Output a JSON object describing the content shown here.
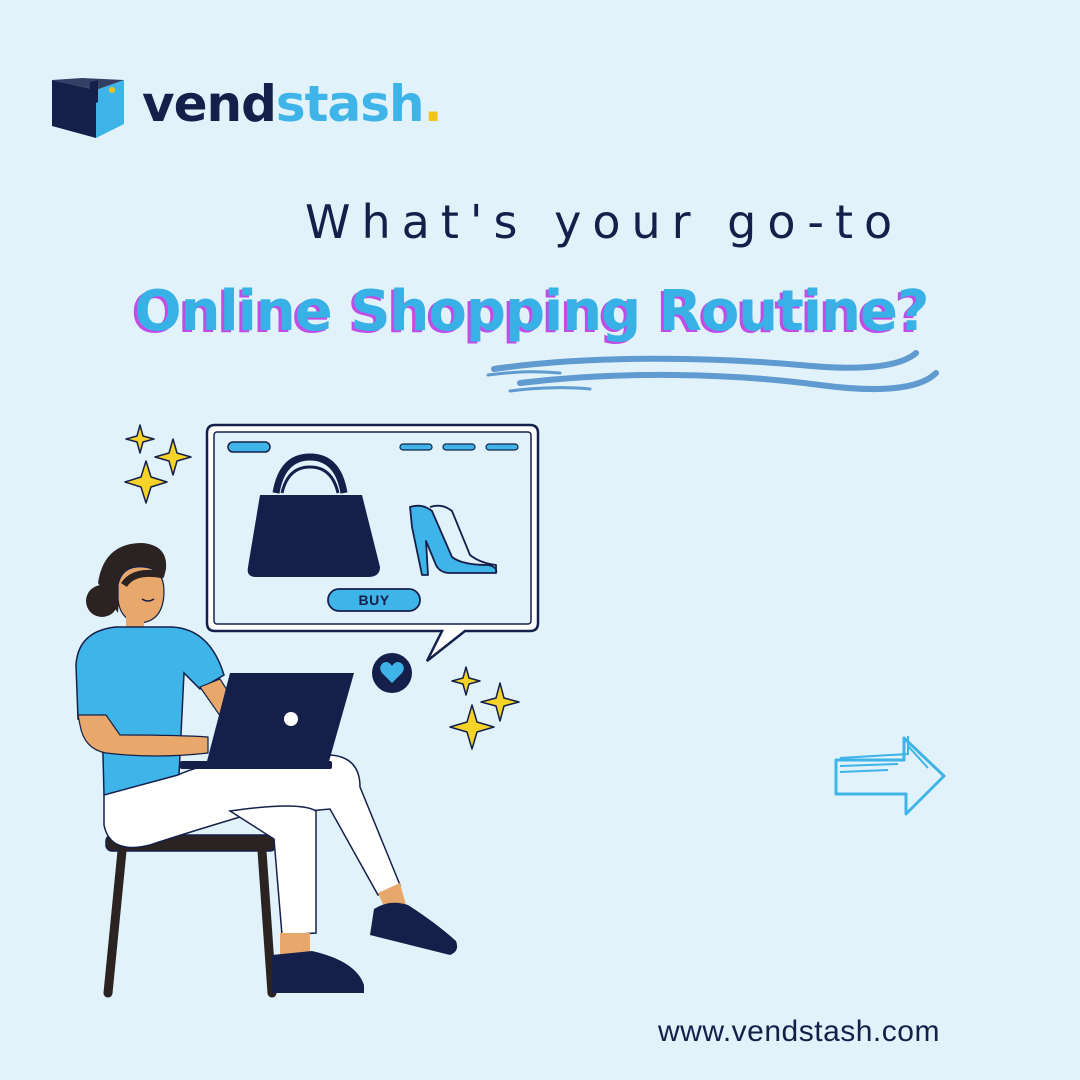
{
  "brand": {
    "name_dark": "vend",
    "name_light": "stash",
    "dot": ".",
    "logo_icon": "folded-box-logo-icon",
    "colors": {
      "navy": "#15204a",
      "sky": "#3fb4e8",
      "accent_yellow": "#f2c418",
      "magenta_shadow": "#c14ce6"
    }
  },
  "headline": {
    "line1": "What's your go-to",
    "line2": "Online Shopping Routine?"
  },
  "illustration": {
    "buy_button_label": "BUY",
    "icons": [
      "handbag-icon",
      "high-heels-icon",
      "heart-icon",
      "sparkle-icon",
      "laptop-icon"
    ]
  },
  "navigation": {
    "arrow_icon": "right-arrow-icon"
  },
  "footer": {
    "website": "www.vendstash.com"
  }
}
